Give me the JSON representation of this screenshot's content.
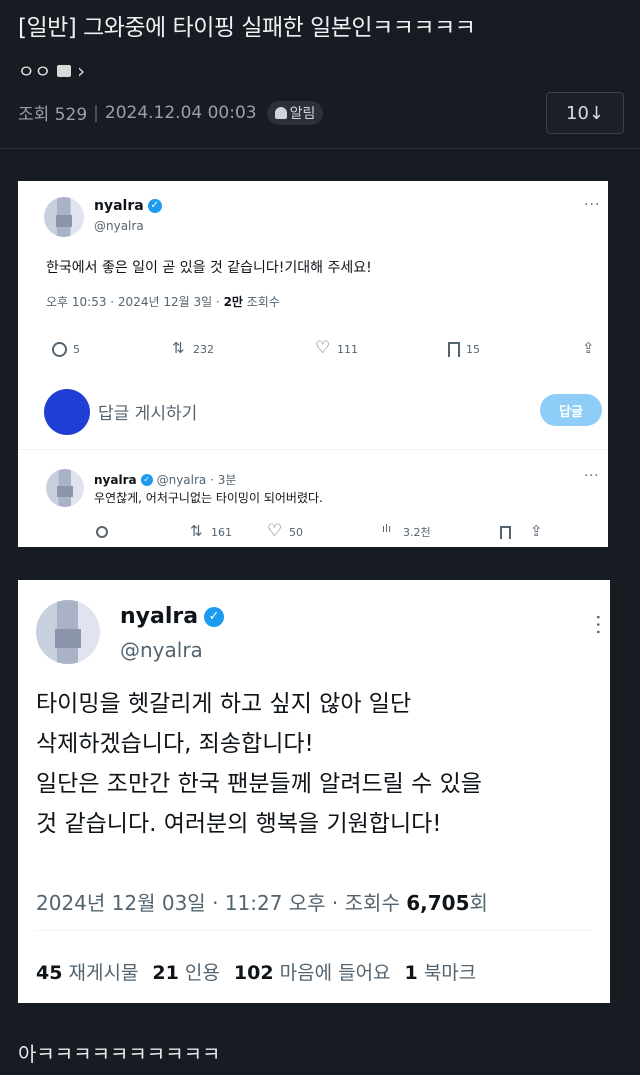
{
  "post": {
    "title": "[일반] 그와중에 타이핑 실패한 일본인ㅋㅋㅋㅋㅋ",
    "author": "ㅇㅇ",
    "views_label": "조회 529",
    "date": "2024.12.04 00:03",
    "alarm_label": "알림",
    "count": "10↓"
  },
  "tweet1": {
    "name": "nyalra",
    "handle": "@nyalra",
    "text": "한국에서 좋은 일이 곧 있을 것 같습니다!기대해 주세요!",
    "date_prefix": "오후 10:53 · 2024년 12월 3일 · ",
    "views_bold": "2만",
    "views_suffix": " 조회수",
    "actions": {
      "reply": "5",
      "retweet": "232",
      "like": "111",
      "bookmark": "15"
    },
    "reply_placeholder": "답글 게시하기",
    "reply_button": "답글"
  },
  "tweet1_reply": {
    "name": "nyalra",
    "handle_time": "@nyalra · 3분",
    "text": "우연찮게, 어처구니없는 타이밍이 되어버렸다.",
    "actions": {
      "retweet": "161",
      "like": "50",
      "views": "3.2천"
    }
  },
  "tweet2": {
    "name": "nyalra",
    "handle": "@nyalra",
    "lines": [
      "타이밍을 헷갈리게 하고 싶지 않아 일단",
      "삭제하겠습니다, 죄송합니다!",
      "일단은 조만간 한국 팬분들께 알려드릴 수 있을",
      "것 같습니다. 여러분의 행복을 기원합니다!"
    ],
    "date_prefix": "2024년 12월 03일 · 11:27 오후 · 조회수 ",
    "views_bold": "6,705",
    "views_suffix": "회",
    "stats": [
      {
        "num": "45",
        "label": "재게시물"
      },
      {
        "num": "21",
        "label": "인용"
      },
      {
        "num": "102",
        "label": "마음에 들어요"
      },
      {
        "num": "1",
        "label": "북마크"
      }
    ]
  },
  "comment_text": "아ㅋㅋㅋㅋㅋㅋㅋㅋㅋㅋ",
  "colors": {
    "background": "#171b22",
    "verified": "#1d9bf0",
    "reply_avatar": "#1f3fd4",
    "reply_button": "#8ecdf8"
  }
}
